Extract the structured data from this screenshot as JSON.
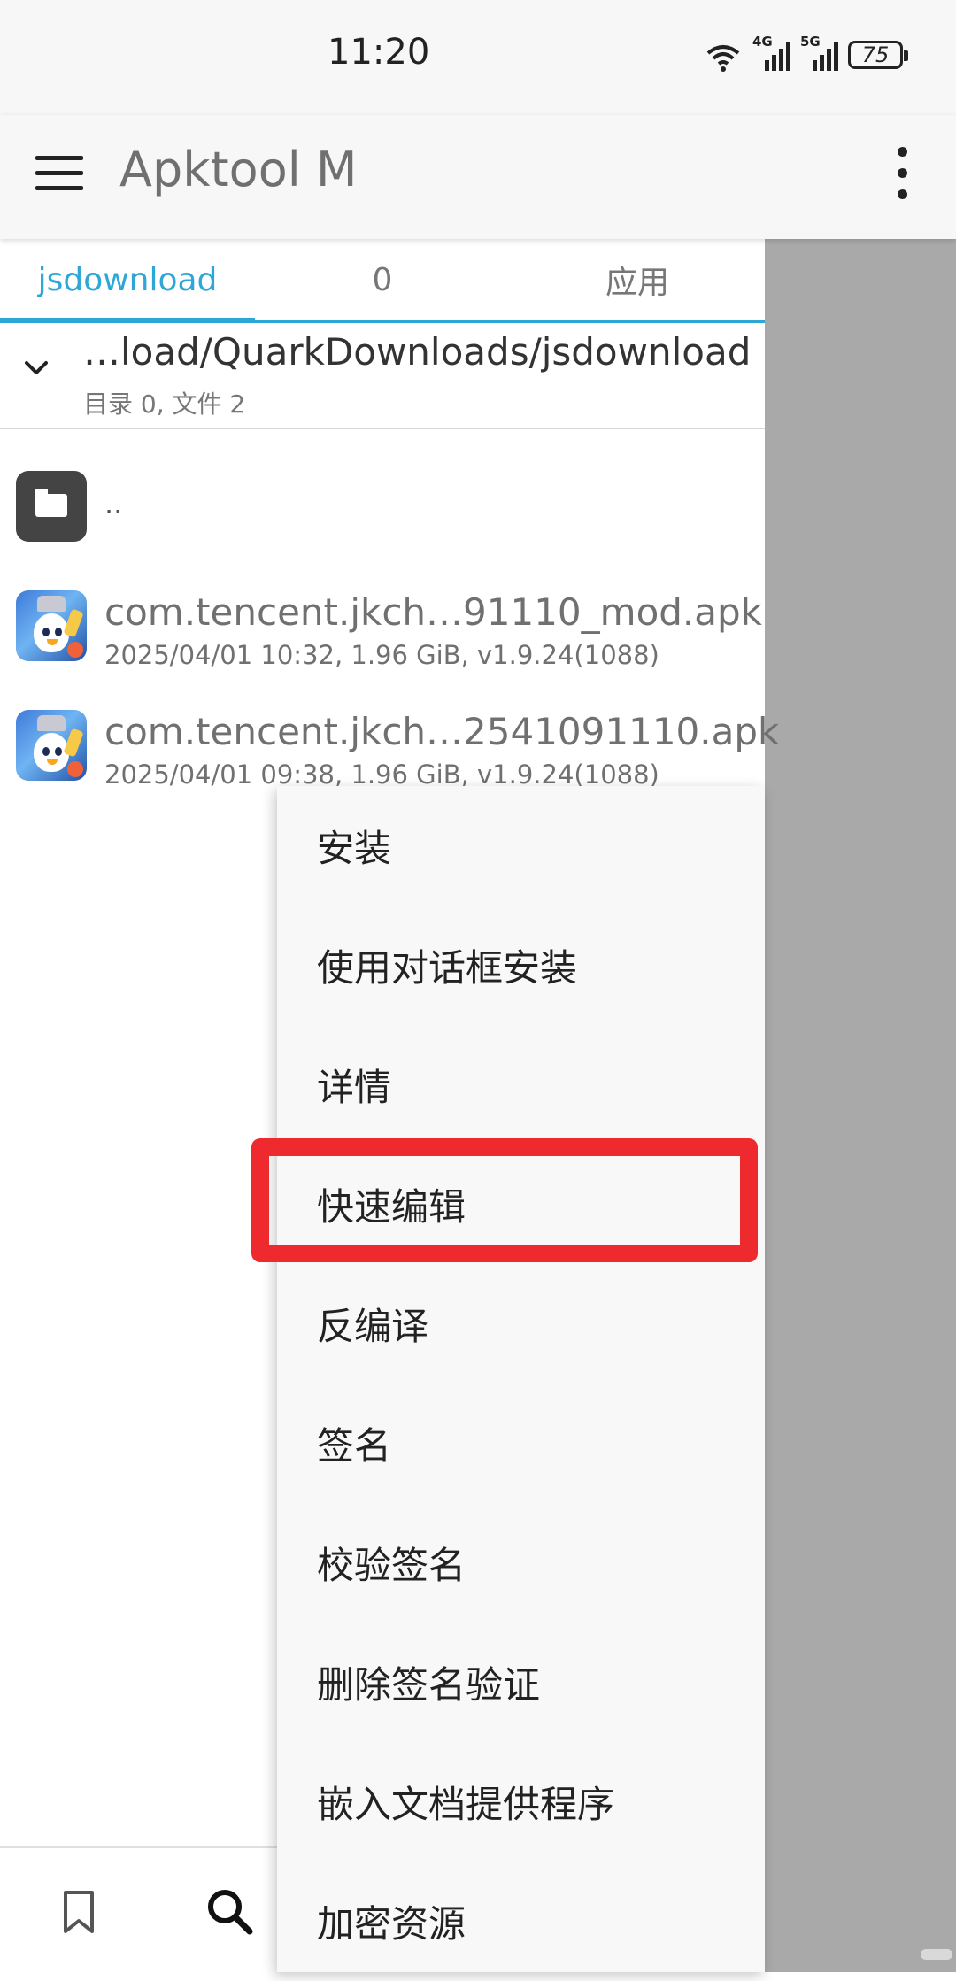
{
  "status_bar": {
    "time": "11:20",
    "battery": "75",
    "signal_labels": [
      "4G",
      "5G"
    ],
    "wifi_label": "6"
  },
  "app_bar": {
    "title": "Apktool M",
    "menu_icon": "hamburger-icon",
    "overflow_icon": "more-vert-icon"
  },
  "tabs": [
    {
      "label": "jsdownload",
      "active": true
    },
    {
      "label": "0",
      "active": false
    },
    {
      "label": "应用",
      "active": false
    }
  ],
  "path_bar": {
    "path": "…load/QuarkDownloads/jsdownload",
    "summary": "目录 0, 文件 2"
  },
  "files": [
    {
      "name": "..",
      "type": "parent-folder"
    },
    {
      "name": "com.tencent.jkch…91110_mod.apk",
      "meta": "2025/04/01 10:32, 1.96 GiB, v1.9.24(1088)"
    },
    {
      "name": "com.tencent.jkch…2541091110.apk",
      "meta": "2025/04/01 09:38, 1.96 GiB, v1.9.24(1088)"
    }
  ],
  "bottom_nav": [
    "bookmark-icon",
    "search-icon"
  ],
  "context_menu": {
    "items": [
      "安装",
      "使用对话框安装",
      "详情",
      "快速编辑",
      "反编译",
      "签名",
      "校验签名",
      "删除签名验证",
      "嵌入文档提供程序",
      "加密资源"
    ],
    "highlighted": "快速编辑"
  },
  "colors": {
    "accent": "#2ea7d6",
    "highlight": "#ee2a2f",
    "scrim": "#a9a9a9"
  }
}
